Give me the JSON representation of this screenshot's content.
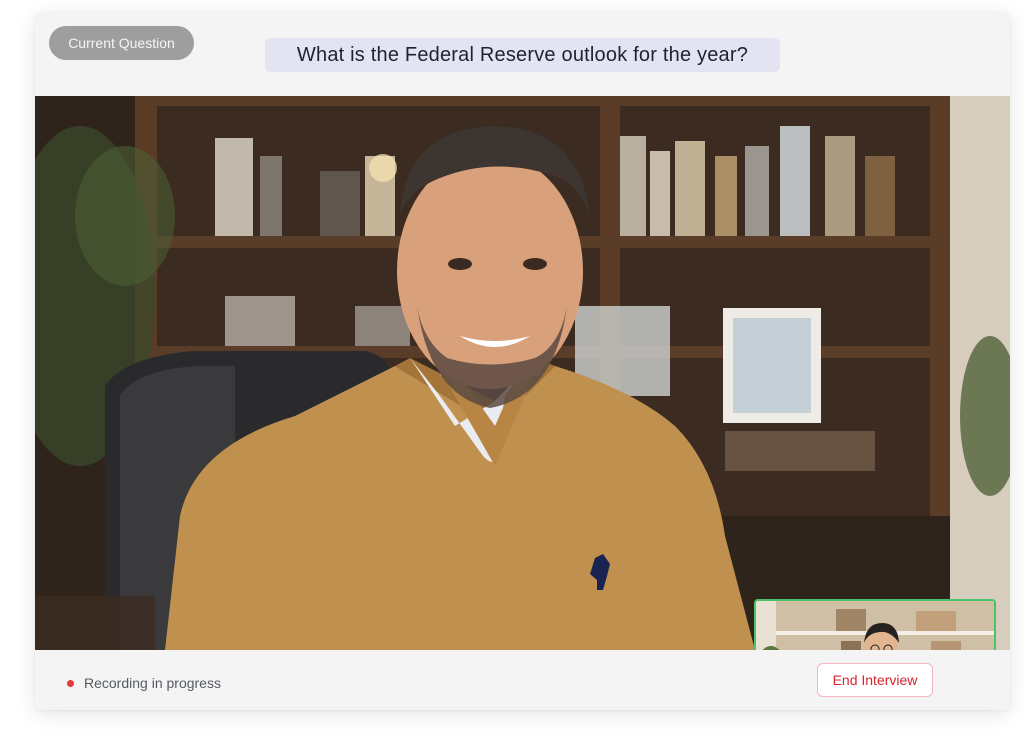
{
  "header": {
    "badge_label": "Current Question",
    "question_text": "What is the Federal Reserve outlook for the year?"
  },
  "footer": {
    "recording_status": "Recording in progress",
    "end_button_label": "End Interview"
  },
  "colors": {
    "badge_bg": "#9e9e9e",
    "question_bg": "#e3e3f2",
    "recording_dot": "#e23b3b",
    "end_button_text": "#d6252f",
    "pip_border": "#4cc36a",
    "pip_status_dot": "#3fd05d"
  }
}
